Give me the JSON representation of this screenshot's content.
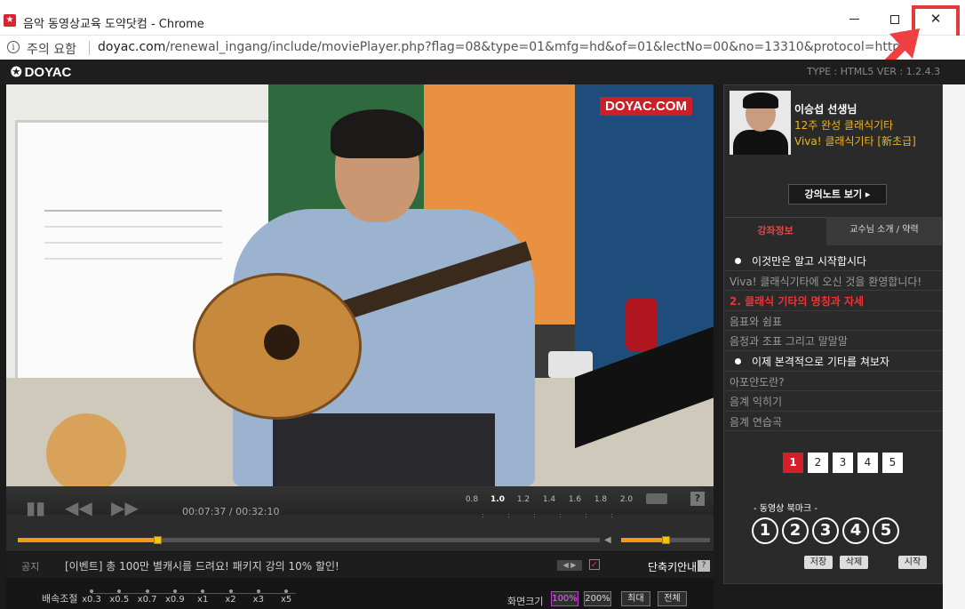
{
  "window": {
    "title": "음악 동영상교육 도약닷컴 - Chrome",
    "favicon_icon": "doyac-star-icon"
  },
  "address": {
    "security_label": "주의 요함",
    "url_host": "doyac.com",
    "url_path": "/renewal_ingang/include/moviePlayer.php?flag=08&type=01&mfg=hd&of=01&lectNo=00&no=13310&protocol=http"
  },
  "player": {
    "logo": "DOYAC",
    "type_text": "TYPE : HTML5 VER : 1.2.4.3",
    "video_brand": "DOYAC.COM",
    "current_time": "00:07:37",
    "total_time": "00:32:10",
    "progress": 0.24,
    "volume": 0.5,
    "speed_marks": [
      "0.8",
      "1.0",
      "1.2",
      "1.4",
      "1.6",
      "1.8",
      "2.0"
    ],
    "speed_active": "1.0",
    "help_label": "?"
  },
  "notice": {
    "label": "공지",
    "text": "[이벤트] 총 100만 별캐시를 드려요! 패키지 강의 10% 할인!",
    "shortcut_label": "단축키안내",
    "shortcut_help": "?"
  },
  "bottom": {
    "rate_label": "배속조절",
    "rates": [
      "x0.3",
      "x0.5",
      "x0.7",
      "x0.9",
      "x1",
      "x2",
      "x3",
      "x5"
    ],
    "screen_label": "화면크기",
    "screen_buttons": [
      "100%",
      "200%",
      "최대",
      "전체"
    ]
  },
  "panel": {
    "teacher": "이승섭 선생님",
    "course_line1": "12주 완성 클래식기타",
    "course_line2": "Viva! 클래식기타 [新초급]",
    "note_button": "강의노트 보기 ▸",
    "tab_info": "강좌정보",
    "tab_profile": "교수님 소개 / 약력",
    "chapters": [
      {
        "text": "이것만은 알고 시작합시다",
        "kind": "section"
      },
      {
        "text": "Viva! 클래식기타에 오신 것을 환영합니다!",
        "kind": "item"
      },
      {
        "text": "2. 클래식 기타의 명칭과 자세",
        "kind": "current"
      },
      {
        "text": "음표와 쉼표",
        "kind": "item"
      },
      {
        "text": "음정과 조표 그리고 말말말",
        "kind": "item"
      },
      {
        "text": "이제 본격적으로 기타를 쳐보자",
        "kind": "section"
      },
      {
        "text": "아포얀도란?",
        "kind": "item"
      },
      {
        "text": "음계 익히기",
        "kind": "item"
      },
      {
        "text": "음계 연습곡",
        "kind": "item"
      }
    ],
    "pages": [
      "1",
      "2",
      "3",
      "4",
      "5"
    ],
    "active_page": "1",
    "bookmark_title": "- 동영상 북마크 -",
    "bookmarks": [
      "1",
      "2",
      "3",
      "4",
      "5"
    ],
    "bookmark_save": "저장",
    "bookmark_delete": "삭제",
    "bookmark_start": "시작"
  }
}
